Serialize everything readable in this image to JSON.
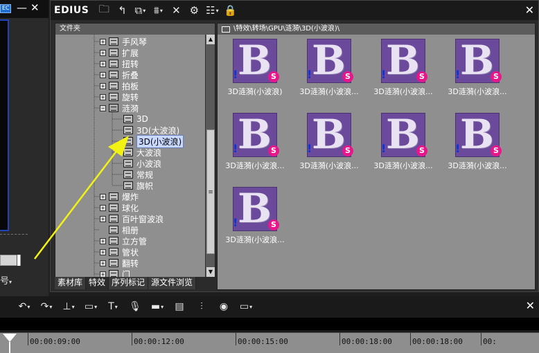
{
  "preview": {
    "badge": "EC",
    "minimize": "—",
    "close": "✕",
    "label": "号"
  },
  "bin": {
    "brand": "EDIUS",
    "toolbar": [
      {
        "name": "folder-button",
        "icon": "🗀"
      },
      {
        "name": "up-folder-button",
        "icon": "↰"
      },
      {
        "name": "add-clip-button",
        "icon": "⧉",
        "dropdown": true
      },
      {
        "name": "add-to-timeline-button",
        "icon": "⩩",
        "dropdown": true
      },
      {
        "name": "delete-button",
        "icon": "✕"
      },
      {
        "name": "properties-button",
        "icon": "⚙"
      },
      {
        "name": "view-mode-button",
        "icon": "☷",
        "dropdown": true
      },
      {
        "name": "lock-button",
        "icon": "🔒"
      }
    ],
    "close": "✕",
    "folder_header": "文件夹",
    "path": "\\特效\\转场\\GPU\\涟漪\\3D(小波浪)\\",
    "tree": [
      {
        "label": "手风琴",
        "level": 1,
        "expander": "+"
      },
      {
        "label": "扩展",
        "level": 1,
        "expander": "+"
      },
      {
        "label": "扭转",
        "level": 1,
        "expander": "+"
      },
      {
        "label": "折叠",
        "level": 1,
        "expander": "+"
      },
      {
        "label": "拍板",
        "level": 1,
        "expander": "+"
      },
      {
        "label": "旋转",
        "level": 1,
        "expander": "+"
      },
      {
        "label": "涟漪",
        "level": 1,
        "expander": "−",
        "open": true
      },
      {
        "label": "3D",
        "level": 2
      },
      {
        "label": "3D(大波浪)",
        "level": 2
      },
      {
        "label": "3D(小波浪)",
        "level": 2,
        "selected": true
      },
      {
        "label": "大波浪",
        "level": 2
      },
      {
        "label": "小波浪",
        "level": 2
      },
      {
        "label": "常规",
        "level": 2
      },
      {
        "label": "旗帜",
        "level": 2
      },
      {
        "label": "爆炸",
        "level": 1,
        "expander": "+"
      },
      {
        "label": "球化",
        "level": 1,
        "expander": "+"
      },
      {
        "label": "百叶窗波浪",
        "level": 1,
        "expander": "+"
      },
      {
        "label": "相册",
        "level": 1
      },
      {
        "label": "立方管",
        "level": 1,
        "expander": "+"
      },
      {
        "label": "管状",
        "level": 1,
        "expander": "+"
      },
      {
        "label": "翻转",
        "level": 1,
        "expander": "+"
      },
      {
        "label": "门",
        "level": 1,
        "expander": "+"
      }
    ],
    "scroll_up": "▲",
    "scroll_down": "▼",
    "scroll_grip": "≡",
    "tabs": [
      "素材库",
      "特效",
      "序列标记",
      "源文件浏览"
    ],
    "clips": [
      {
        "label": "3D涟漪(小波浪)"
      },
      {
        "label": "3D涟漪(小波浪..."
      },
      {
        "label": "3D涟漪(小波浪..."
      },
      {
        "label": "3D涟漪(小波浪..."
      },
      {
        "label": "3D涟漪(小波浪..."
      },
      {
        "label": "3D涟漪(小波浪..."
      },
      {
        "label": "3D涟漪(小波浪..."
      },
      {
        "label": "3D涟漪(小波浪..."
      },
      {
        "label": "3D涟漪(小波浪..."
      }
    ],
    "thumb_glyph": "B",
    "thumb_warn": "!",
    "thumb_badge": "S"
  },
  "timeline": {
    "toolbar": [
      {
        "name": "undo-button",
        "icon": "↶",
        "dropdown": true
      },
      {
        "name": "redo-button",
        "icon": "↷",
        "dropdown": true
      },
      {
        "name": "insert-mode-button",
        "icon": "⊥",
        "dropdown": true
      },
      {
        "name": "ripple-button",
        "icon": "▭",
        "dropdown": true
      },
      {
        "name": "title-button",
        "icon": "T",
        "dropdown": true
      },
      {
        "name": "voiceover-button",
        "icon": "🎙"
      },
      {
        "name": "render-button",
        "icon": "▬",
        "dropdown": true
      },
      {
        "name": "sequence-button",
        "icon": "▤"
      },
      {
        "name": "mixer-button",
        "icon": "⫶"
      },
      {
        "name": "color-button",
        "icon": "◉"
      },
      {
        "name": "panel-button",
        "icon": "▭",
        "dropdown": true
      }
    ],
    "close": "✕",
    "ruler": [
      "00:00:09:00",
      "00:00:12:00",
      "00:00:15:00",
      "00:00:18:00",
      "00:00:18:00",
      "00:"
    ]
  },
  "colors": {
    "pane_gray": "#8f8f8f",
    "thumb_purple": "#6b4a9c",
    "badge_pink": "#e8168a",
    "arrow_yellow": "#f3f313"
  }
}
